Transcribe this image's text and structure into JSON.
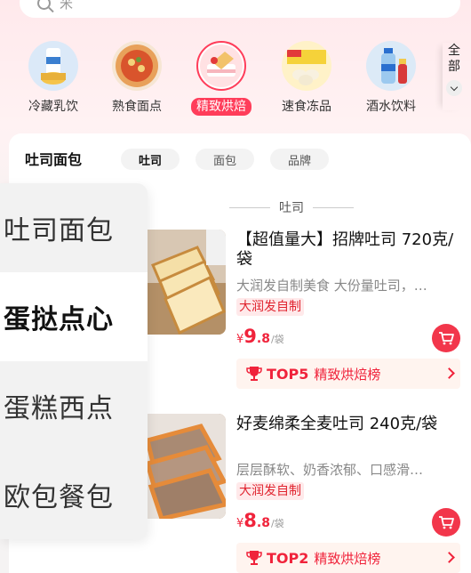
{
  "search": {
    "placeholder": "米"
  },
  "categories": [
    {
      "label": "冷藏乳饮",
      "active": false
    },
    {
      "label": "熟食面点",
      "active": false
    },
    {
      "label": "精致烘焙",
      "active": true
    },
    {
      "label": "速食冻品",
      "active": false
    },
    {
      "label": "酒水饮料",
      "active": false
    }
  ],
  "all_button": {
    "label": "全部"
  },
  "sub_category_title": "吐司面包",
  "chips": [
    "吐司",
    "面包",
    "品牌"
  ],
  "left_nav": [
    "吐司面包",
    "蛋挞点心",
    "蛋糕西点",
    "欧包餐包"
  ],
  "section_title": "吐司",
  "products": [
    {
      "name": "【超值量大】招牌吐司 720克/袋",
      "desc": "大润发自制美食 大份量吐司，…",
      "tag": "大润发自制",
      "price_currency": "¥",
      "price_int": "9",
      "price_dec": ".8",
      "price_unit": "/袋",
      "rank": "TOP5",
      "rank_list": "精致烘焙榜"
    },
    {
      "name": "好麦绵柔全麦吐司 240克/袋",
      "desc": "层层酥软、奶香浓郁、口感滑…",
      "tag": "大润发自制",
      "price_currency": "¥",
      "price_int": "8",
      "price_dec": ".8",
      "price_unit": "/袋",
      "rank": "TOP2",
      "rank_list": "精致烘焙榜"
    }
  ],
  "colors": {
    "accent": "#ff3d5a",
    "price": "#f0233b",
    "tag_bg": "#ffe9ea"
  }
}
